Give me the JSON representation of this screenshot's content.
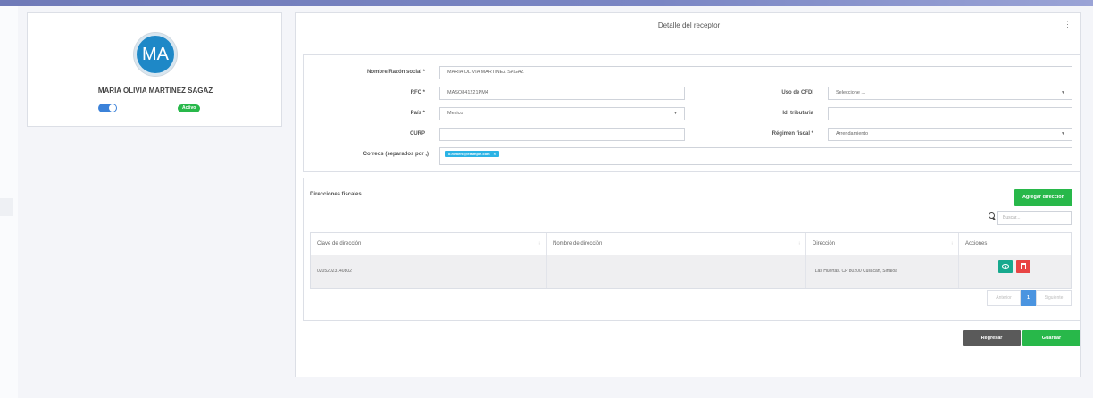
{
  "profile": {
    "initials": "MA",
    "name": "MARIA OLIVIA MARTINEZ SAGAZ",
    "status_badge": "Activo",
    "toggle_on": true
  },
  "main": {
    "title": "Detalle del receptor",
    "menu_icon": "kebab-vertical-icon"
  },
  "form": {
    "nombre_label": "Nombre/Razón social *",
    "nombre_value": "MARIA OLIVIA MARTINEZ SAGAZ",
    "rfc_label": "RFC *",
    "rfc_value": "MASO841221PM4",
    "uso_cfdi_label": "Uso de CFDI",
    "uso_cfdi_value": "Seleccione ...",
    "pais_label": "País *",
    "pais_value": "Mexico",
    "id_tributaria_label": "Id. tributaria",
    "id_tributaria_value": "",
    "curp_label": "CURP",
    "curp_value": "",
    "regimen_label": "Régimen fiscal *",
    "regimen_value": "Arrendamiento",
    "correos_label": "Correos (separados por ,)",
    "correo_chip": "o.romero@example.com",
    "chip_remove": "×"
  },
  "direcciones": {
    "title": "Direcciones fiscales",
    "add_button": "Agregar dirección",
    "search_placeholder": "Buscar...",
    "columns": [
      "Clave de dirección",
      "Nombre de dirección",
      "Dirección",
      "Acciones"
    ],
    "rows": [
      {
        "clave": "02052023140802",
        "nombre": "",
        "direccion": ", Las Huertas. CP 80200 Culiacán, Sinaloa"
      }
    ],
    "pagination": {
      "prev": "Anterior",
      "current": "1",
      "next": "Siguiente"
    }
  },
  "footer": {
    "back_button": "Regresar",
    "save_button": "Guardar"
  },
  "colors": {
    "accent_green": "#28b84a",
    "accent_blue": "#1e88c7",
    "danger": "#e84545",
    "teal": "#17a98e"
  }
}
